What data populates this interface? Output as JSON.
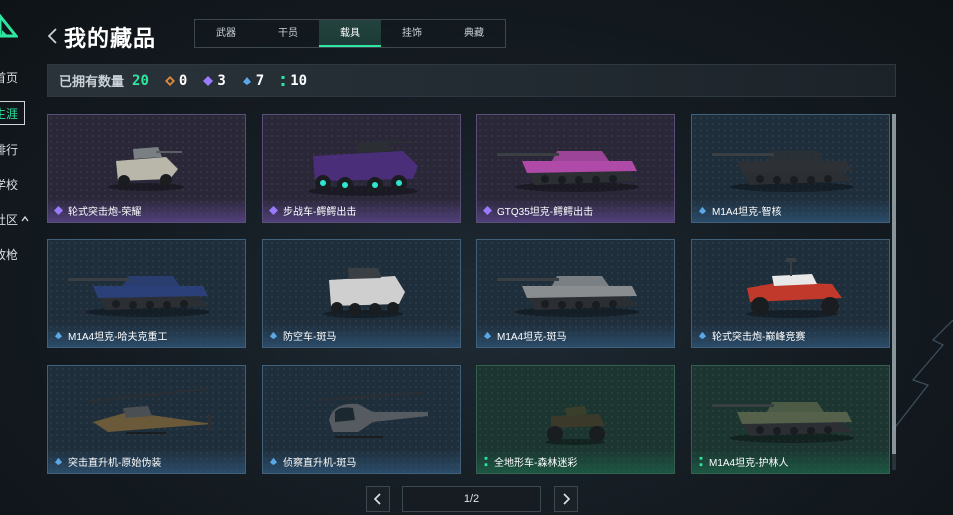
{
  "sidebar": {
    "items": [
      {
        "label": "首页",
        "active": false
      },
      {
        "label": "生涯",
        "active": true
      },
      {
        "label": "排行",
        "active": false
      },
      {
        "label": "学校",
        "active": false
      },
      {
        "label": "社区",
        "active": false
      },
      {
        "label": "改枪",
        "active": false
      }
    ]
  },
  "header": {
    "title": "我的藏品",
    "tabs": [
      {
        "label": "武器",
        "active": false
      },
      {
        "label": "干员",
        "active": false
      },
      {
        "label": "载具",
        "active": true
      },
      {
        "label": "挂饰",
        "active": false
      },
      {
        "label": "典藏",
        "active": false
      }
    ]
  },
  "counts": {
    "label": "已拥有数量",
    "total": "20",
    "rarities": [
      {
        "icon": "orange-diamond-icon",
        "color": "#e08a3a",
        "value": "0"
      },
      {
        "icon": "purple-diamond-icon",
        "color": "#9a7bff",
        "value": "3"
      },
      {
        "icon": "blue-diamond-icon",
        "color": "#5aa8e8",
        "value": "7"
      },
      {
        "icon": "green-diamond-icon",
        "color": "#2fe6a0",
        "value": "10"
      }
    ]
  },
  "items": [
    {
      "name": "轮式突击炮-荣耀",
      "rarity": "purple",
      "vehicle": "armored-car"
    },
    {
      "name": "步战车-鳄鳄出击",
      "rarity": "purple",
      "vehicle": "ifv"
    },
    {
      "name": "GTQ35坦克-鳄鳄出击",
      "rarity": "purple",
      "vehicle": "tank"
    },
    {
      "name": "M1A4坦克-智核",
      "rarity": "blue",
      "vehicle": "tank"
    },
    {
      "name": "M1A4坦克-哈夫克重工",
      "rarity": "blue",
      "vehicle": "tank"
    },
    {
      "name": "防空车-斑马",
      "rarity": "blue",
      "vehicle": "apc"
    },
    {
      "name": "M1A4坦克-斑马",
      "rarity": "blue",
      "vehicle": "tank"
    },
    {
      "name": "轮式突击炮-巅峰竞赛",
      "rarity": "blue",
      "vehicle": "buggy"
    },
    {
      "name": "突击直升机-原始伪装",
      "rarity": "blue",
      "vehicle": "attack-heli"
    },
    {
      "name": "侦察直升机-斑马",
      "rarity": "blue",
      "vehicle": "scout-heli"
    },
    {
      "name": "全地形车-森林迷彩",
      "rarity": "green",
      "vehicle": "atv"
    },
    {
      "name": "M1A4坦克-护林人",
      "rarity": "green",
      "vehicle": "tank"
    }
  ],
  "pagination": {
    "current": "1/2"
  },
  "colors": {
    "accent": "#2fe6a0",
    "purple": "#9a7bff",
    "blue": "#5aa8e8",
    "green": "#2fe6a0"
  }
}
